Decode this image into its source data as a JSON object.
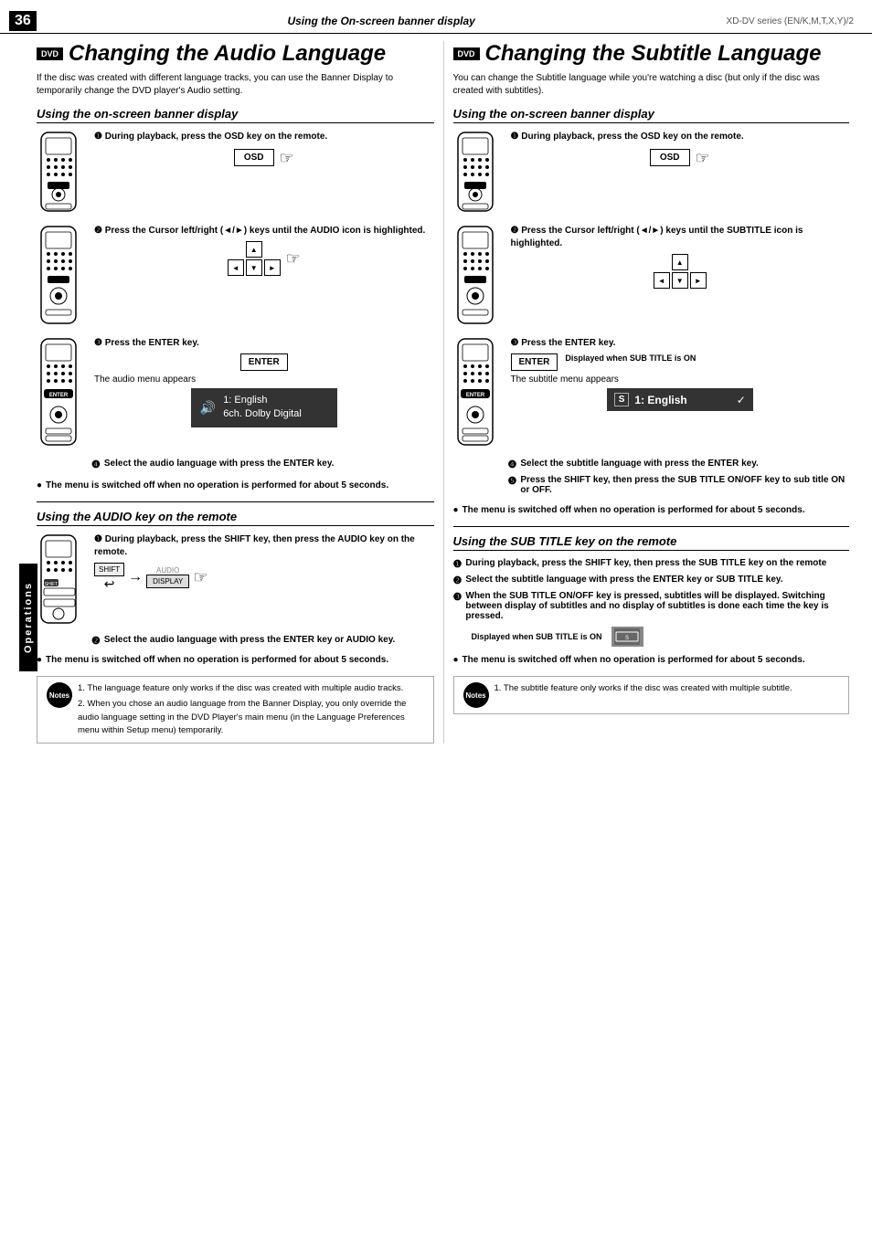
{
  "page": {
    "number": "36",
    "title": "Using the On-screen banner display",
    "series": "XD-DV series (EN/K,M,T,X,Y)/2"
  },
  "side_tab": "Operations",
  "left_column": {
    "main_title": "Changing the Audio Language",
    "dvd_badge": "DVD",
    "intro_text": "If the disc was created with different language tracks, you can use the Banner Display to temporarily change the DVD player's Audio setting.",
    "banner_section": {
      "title": "Using the on-screen banner display",
      "step1": {
        "number": "❶",
        "label": "During playback, press  the OSD key on the remote.",
        "button_label": "OSD"
      },
      "step2": {
        "number": "❷",
        "label": "Press the Cursor left/right (◄/►) keys until the AUDIO icon is highlighted."
      },
      "step3": {
        "number": "❸",
        "label": "Press the ENTER key.",
        "button_label": "ENTER"
      },
      "menu_appears": "The audio menu appears",
      "audio_menu_line1": "1: English",
      "audio_menu_line2": "6ch. Dolby Digital",
      "step4": {
        "number": "❹",
        "label": "Select  the audio language with press the ENTER key."
      }
    },
    "bullet_note": "The menu is switched off when no operation is performed for about 5 seconds.",
    "audio_key_section": {
      "title": "Using the AUDIO key on the remote",
      "step1": {
        "number": "❶",
        "label": "During playback, press  the SHIFT key, then press the AUDIO key on the remote.",
        "shift_label": "SHIFT",
        "audio_label": "AUDIO",
        "display_label": "DISPLAY"
      },
      "step2": {
        "number": "❷",
        "label": "Select the audio language with press the ENTER key or AUDIO key."
      }
    },
    "bullet_note2": "The menu is switched off when no operation is performed for about 5 seconds.",
    "notes": {
      "label": "Notes",
      "items": [
        "1. The language feature only works if the disc was created with multiple audio tracks.",
        "2. When you chose an audio language from the Banner Display, you only override the audio language setting in the DVD Player's main menu (in the Language Preferences menu within Setup menu) temporarily."
      ]
    }
  },
  "right_column": {
    "main_title": "Changing the Subtitle Language",
    "dvd_badge": "DVD",
    "intro_text": "You can change the Subtitle language while you're watching a disc (but only if the disc was created with subtitles).",
    "banner_section": {
      "title": "Using the on-screen banner display",
      "step1": {
        "number": "❶",
        "label": "During playback, press  the OSD key on the remote.",
        "button_label": "OSD"
      },
      "step2": {
        "number": "❷",
        "label": "Press the Cursor left/right (◄/►) keys until the SUBTITLE icon is highlighted."
      },
      "step3": {
        "number": "❸",
        "label": "Press the ENTER key.",
        "button_label": "ENTER",
        "displayed_when": "Displayed when SUB TITLE is ON"
      },
      "menu_appears": "The subtitle menu appears",
      "subtitle_menu": "1: English",
      "step4": {
        "number": "❹",
        "label": "Select the subtitle language with press the ENTER key."
      },
      "step5": {
        "number": "❺",
        "label": "Press the SHIFT key, then press the SUB TITLE ON/OFF key to sub title ON or OFF."
      }
    },
    "bullet_note": "The menu is switched off when no operation is performed for about 5 seconds.",
    "subtitle_key_section": {
      "title": "Using the SUB TITLE key on the remote",
      "step1": {
        "number": "❶",
        "label": "During playback, press  the SHIFT key, then press the SUB TITLE key on the remote"
      },
      "step2": {
        "number": "❷",
        "label": "Select  the subtitle language with press the ENTER key or SUB TITLE key."
      },
      "step3": {
        "number": "❸",
        "label": "When the SUB TITLE ON/OFF key is pressed, subtitles will be displayed. Switching between display of subtitles and no display of subtitles is done each time the key is pressed."
      },
      "displayed_when": "Displayed when SUB TITLE is ON"
    },
    "bullet_note2": "The menu is switched off when no operation is performed for about 5 seconds.",
    "notes": {
      "label": "Notes",
      "items": [
        "1. The subtitle feature only works if the disc was created with multiple subtitle."
      ]
    }
  }
}
